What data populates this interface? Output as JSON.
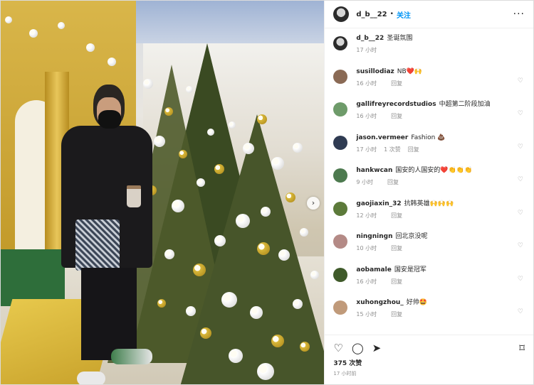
{
  "post": {
    "username": "d_b__22",
    "follow_label": "关注",
    "caption": "圣诞氛围",
    "caption_time": "17 小时",
    "likes": "375 次赞",
    "posted": "17 小时前"
  },
  "comments": [
    {
      "user": "susillodiaz",
      "text": "NB❤️🙌",
      "time": "16 小时",
      "reply": "回复",
      "likes": "",
      "avatar_color": "#8a6a55"
    },
    {
      "user": "gallifreyrecordstudios",
      "text": "中超第二阶段加油",
      "time": "16 小时",
      "reply": "回复",
      "likes": "",
      "avatar_color": "#6e9b6a"
    },
    {
      "user": "jason.vermeer",
      "text": "Fashion 💩",
      "time": "17 小时",
      "reply": "回复",
      "likes": "1 次赞",
      "avatar_color": "#2f3b52"
    },
    {
      "user": "hankwcan",
      "text": "国安的人国安的❤️👏👏👏",
      "time": "9 小时",
      "reply": "回复",
      "likes": "",
      "avatar_color": "#4d7a4f"
    },
    {
      "user": "gaojiaxin_32",
      "text": "抗韩英雄🙌🙌🙌",
      "time": "12 小时",
      "reply": "回复",
      "likes": "",
      "avatar_color": "#5c7a3a"
    },
    {
      "user": "ningningn",
      "text": "回北京没呢",
      "time": "10 小时",
      "reply": "回复",
      "likes": "",
      "avatar_color": "#b48a86"
    },
    {
      "user": "aobamale",
      "text": "国安是冠军",
      "time": "16 小时",
      "reply": "回复",
      "likes": "",
      "avatar_color": "#3f5a2a"
    },
    {
      "user": "xuhongzhou_",
      "text": "好帅🤩",
      "time": "15 小时",
      "reply": "回复",
      "likes": "",
      "avatar_color": "#c09a7a"
    }
  ],
  "icons": {
    "more": "more-icon",
    "heart": "heart-icon",
    "comment": "comment-icon",
    "share": "share-icon",
    "save": "bookmark-icon",
    "next": "chevron-right-icon"
  },
  "colors": {
    "accent": "#0095f6",
    "muted": "#8e8e8e",
    "text": "#262626"
  }
}
